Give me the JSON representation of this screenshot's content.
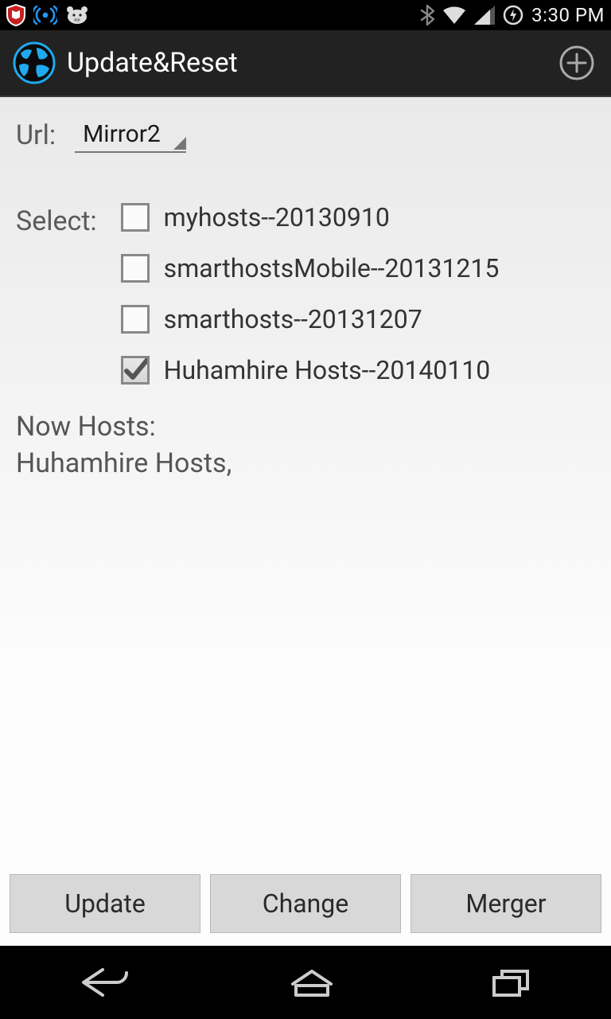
{
  "status": {
    "time": "3:30 PM"
  },
  "actionbar": {
    "title": "Update&Reset"
  },
  "main": {
    "url_label": "Url:",
    "url_value": "Mirror2",
    "select_label": "Select:",
    "options": [
      {
        "label": "myhosts--20130910",
        "checked": false
      },
      {
        "label": "smarthostsMobile--20131215",
        "checked": false
      },
      {
        "label": "smarthosts--20131207",
        "checked": false
      },
      {
        "label": "Huhamhire Hosts--20140110",
        "checked": true
      }
    ],
    "now_hosts_label": "Now Hosts:",
    "now_hosts_value": "Huhamhire Hosts,"
  },
  "buttons": {
    "update": "Update",
    "change": "Change",
    "merger": "Merger"
  }
}
